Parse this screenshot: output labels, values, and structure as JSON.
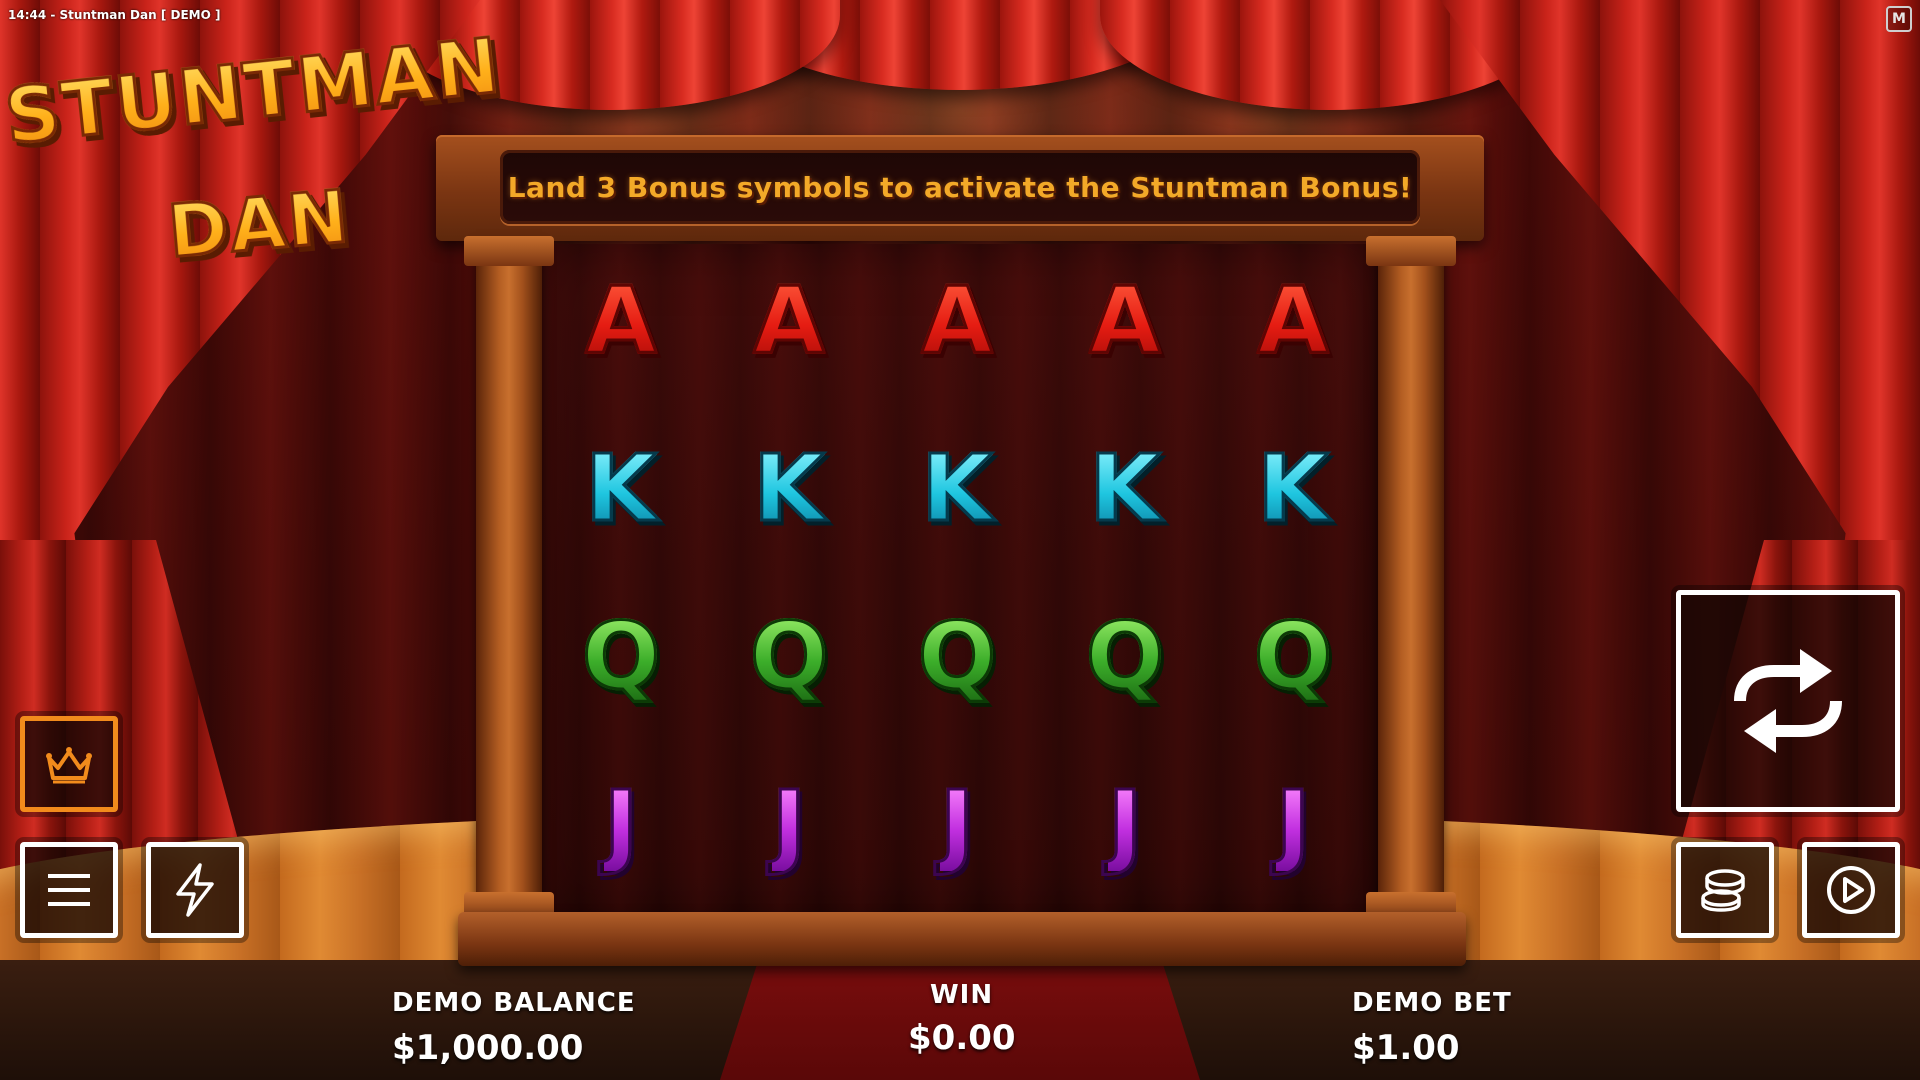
{
  "window": {
    "title": "14:44  -  Stuntman Dan  [ DEMO ]",
    "badge": "M"
  },
  "logo": {
    "line1": "STUNTMAN",
    "line2": "DAN"
  },
  "message": "Land 3 Bonus symbols to activate the Stuntman Bonus!",
  "reels": [
    [
      "A",
      "A",
      "A",
      "A",
      "A"
    ],
    [
      "K",
      "K",
      "K",
      "K",
      "K"
    ],
    [
      "Q",
      "Q",
      "Q",
      "Q",
      "Q"
    ],
    [
      "J",
      "J",
      "J",
      "J",
      "J"
    ]
  ],
  "buttons": {
    "vip": "crown-icon",
    "menu": "hamburger-icon",
    "turbo": "lightning-icon",
    "spin": "spin-arrows-icon",
    "bet": "coins-icon",
    "autoplay": "play-icon"
  },
  "balance": {
    "label": "DEMO BALANCE",
    "value": "$1,000.00"
  },
  "win": {
    "label": "WIN",
    "value": "$0.00"
  },
  "bet": {
    "label": "DEMO BET",
    "value": "$1.00"
  },
  "colors": {
    "vip_border": "#f28b1c",
    "message_text": "#f3a928",
    "button_border": "#ffffff"
  }
}
